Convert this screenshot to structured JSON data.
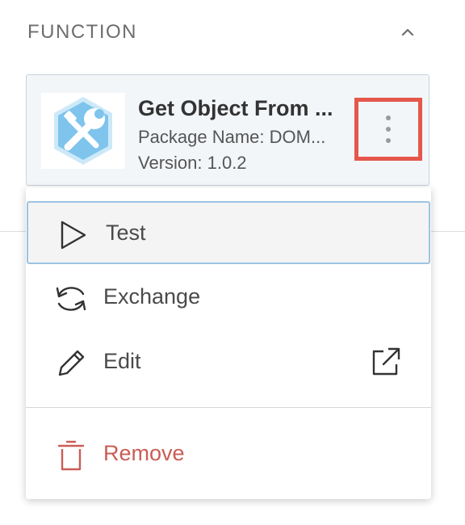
{
  "section": {
    "title": "FUNCTION"
  },
  "function_card": {
    "title": "Get Object From ...",
    "package": "Package Name: DOM...",
    "version": "Version: 1.0.2",
    "icon": "wrench-icon",
    "kebab_icon": "more-vertical-icon"
  },
  "menu": {
    "items": [
      {
        "label": "Test",
        "icon": "play-icon",
        "state": "highlighted"
      },
      {
        "label": "Exchange",
        "icon": "exchange-icon"
      },
      {
        "label": "Edit",
        "icon": "pencil-icon",
        "trailing_icon": "external-link-icon"
      },
      {
        "label": "Remove",
        "icon": "trash-icon",
        "color": "#c95d55"
      }
    ]
  },
  "colors": {
    "card_bg": "#f3f6f9",
    "highlight_border": "#e5574b",
    "active_item_border": "#9cc3e4",
    "danger": "#c95d55",
    "icon_hex": "#7ec4ec"
  }
}
